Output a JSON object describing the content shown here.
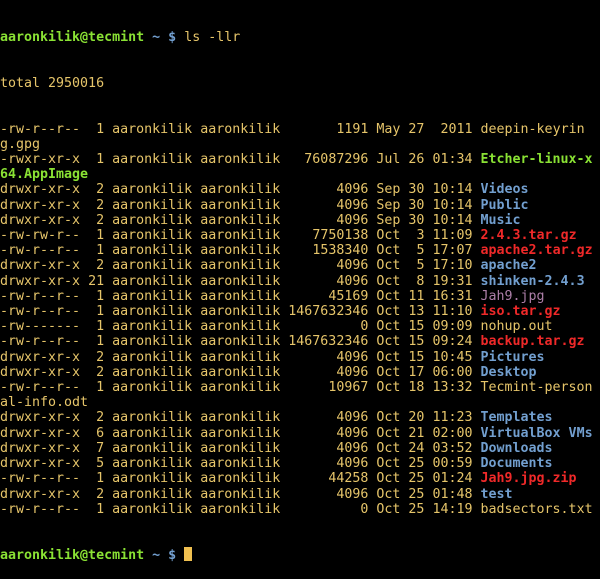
{
  "prompt": {
    "user_host": "aaronkilik@tecmint",
    "path": "~",
    "symbol": "$",
    "command": "ls -llr"
  },
  "total_line": "total 2950016",
  "colors": {
    "text": "#e6c56a",
    "prompt": "#8ae234",
    "directory": "#729fcf",
    "archive": "#ef2929",
    "image": "#ad7fa8",
    "executable": "#8ae234"
  },
  "entries": [
    {
      "perms": "-rw-r--r--",
      "links": "1",
      "owner": "aaronkilik",
      "group": "aaronkilik",
      "size": "1191",
      "month": "May",
      "day": "27",
      "time": "2011",
      "name": "deepin-keyring.gpg",
      "type": "regular"
    },
    {
      "perms": "-rwxr-xr-x",
      "links": "1",
      "owner": "aaronkilik",
      "group": "aaronkilik",
      "size": "76087296",
      "month": "Jul",
      "day": "26",
      "time": "01:34",
      "name": "Etcher-linux-x64.AppImage",
      "type": "exec"
    },
    {
      "perms": "drwxr-xr-x",
      "links": "2",
      "owner": "aaronkilik",
      "group": "aaronkilik",
      "size": "4096",
      "month": "Sep",
      "day": "30",
      "time": "10:14",
      "name": "Videos",
      "type": "dir"
    },
    {
      "perms": "drwxr-xr-x",
      "links": "2",
      "owner": "aaronkilik",
      "group": "aaronkilik",
      "size": "4096",
      "month": "Sep",
      "day": "30",
      "time": "10:14",
      "name": "Public",
      "type": "dir"
    },
    {
      "perms": "drwxr-xr-x",
      "links": "2",
      "owner": "aaronkilik",
      "group": "aaronkilik",
      "size": "4096",
      "month": "Sep",
      "day": "30",
      "time": "10:14",
      "name": "Music",
      "type": "dir"
    },
    {
      "perms": "-rw-rw-r--",
      "links": "1",
      "owner": "aaronkilik",
      "group": "aaronkilik",
      "size": "7750138",
      "month": "Oct",
      "day": "3",
      "time": "11:09",
      "name": "2.4.3.tar.gz",
      "type": "archive"
    },
    {
      "perms": "-rw-r--r--",
      "links": "1",
      "owner": "aaronkilik",
      "group": "aaronkilik",
      "size": "1538340",
      "month": "Oct",
      "day": "5",
      "time": "17:07",
      "name": "apache2.tar.gz",
      "type": "archive"
    },
    {
      "perms": "drwxr-xr-x",
      "links": "2",
      "owner": "aaronkilik",
      "group": "aaronkilik",
      "size": "4096",
      "month": "Oct",
      "day": "5",
      "time": "17:10",
      "name": "apache2",
      "type": "dir"
    },
    {
      "perms": "drwxr-xr-x",
      "links": "21",
      "owner": "aaronkilik",
      "group": "aaronkilik",
      "size": "4096",
      "month": "Oct",
      "day": "8",
      "time": "19:31",
      "name": "shinken-2.4.3",
      "type": "dir"
    },
    {
      "perms": "-rw-r--r--",
      "links": "1",
      "owner": "aaronkilik",
      "group": "aaronkilik",
      "size": "45169",
      "month": "Oct",
      "day": "11",
      "time": "16:31",
      "name": "Jah9.jpg",
      "type": "image"
    },
    {
      "perms": "-rw-r--r--",
      "links": "1",
      "owner": "aaronkilik",
      "group": "aaronkilik",
      "size": "1467632346",
      "month": "Oct",
      "day": "13",
      "time": "11:10",
      "name": "iso.tar.gz",
      "type": "archive"
    },
    {
      "perms": "-rw-------",
      "links": "1",
      "owner": "aaronkilik",
      "group": "aaronkilik",
      "size": "0",
      "month": "Oct",
      "day": "15",
      "time": "09:09",
      "name": "nohup.out",
      "type": "regular"
    },
    {
      "perms": "-rw-r--r--",
      "links": "1",
      "owner": "aaronkilik",
      "group": "aaronkilik",
      "size": "1467632346",
      "month": "Oct",
      "day": "15",
      "time": "09:24",
      "name": "backup.tar.gz",
      "type": "archive"
    },
    {
      "perms": "drwxr-xr-x",
      "links": "2",
      "owner": "aaronkilik",
      "group": "aaronkilik",
      "size": "4096",
      "month": "Oct",
      "day": "15",
      "time": "10:45",
      "name": "Pictures",
      "type": "dir"
    },
    {
      "perms": "drwxr-xr-x",
      "links": "2",
      "owner": "aaronkilik",
      "group": "aaronkilik",
      "size": "4096",
      "month": "Oct",
      "day": "17",
      "time": "06:00",
      "name": "Desktop",
      "type": "dir"
    },
    {
      "perms": "-rw-r--r--",
      "links": "1",
      "owner": "aaronkilik",
      "group": "aaronkilik",
      "size": "10967",
      "month": "Oct",
      "day": "18",
      "time": "13:32",
      "name": "Tecmint-personal-info.odt",
      "type": "regular"
    },
    {
      "perms": "drwxr-xr-x",
      "links": "2",
      "owner": "aaronkilik",
      "group": "aaronkilik",
      "size": "4096",
      "month": "Oct",
      "day": "20",
      "time": "11:23",
      "name": "Templates",
      "type": "dir"
    },
    {
      "perms": "drwxr-xr-x",
      "links": "6",
      "owner": "aaronkilik",
      "group": "aaronkilik",
      "size": "4096",
      "month": "Oct",
      "day": "21",
      "time": "02:00",
      "name": "VirtualBox VMs",
      "type": "dir"
    },
    {
      "perms": "drwxr-xr-x",
      "links": "7",
      "owner": "aaronkilik",
      "group": "aaronkilik",
      "size": "4096",
      "month": "Oct",
      "day": "24",
      "time": "03:52",
      "name": "Downloads",
      "type": "dir"
    },
    {
      "perms": "drwxr-xr-x",
      "links": "5",
      "owner": "aaronkilik",
      "group": "aaronkilik",
      "size": "4096",
      "month": "Oct",
      "day": "25",
      "time": "00:59",
      "name": "Documents",
      "type": "dir"
    },
    {
      "perms": "-rw-r--r--",
      "links": "1",
      "owner": "aaronkilik",
      "group": "aaronkilik",
      "size": "44258",
      "month": "Oct",
      "day": "25",
      "time": "01:24",
      "name": "Jah9.jpg.zip",
      "type": "archive"
    },
    {
      "perms": "drwxr-xr-x",
      "links": "2",
      "owner": "aaronkilik",
      "group": "aaronkilik",
      "size": "4096",
      "month": "Oct",
      "day": "25",
      "time": "01:48",
      "name": "test",
      "type": "dir"
    },
    {
      "perms": "-rw-r--r--",
      "links": "1",
      "owner": "aaronkilik",
      "group": "aaronkilik",
      "size": "0",
      "month": "Oct",
      "day": "25",
      "time": "14:19",
      "name": "badsectors.txt",
      "type": "regular"
    }
  ]
}
